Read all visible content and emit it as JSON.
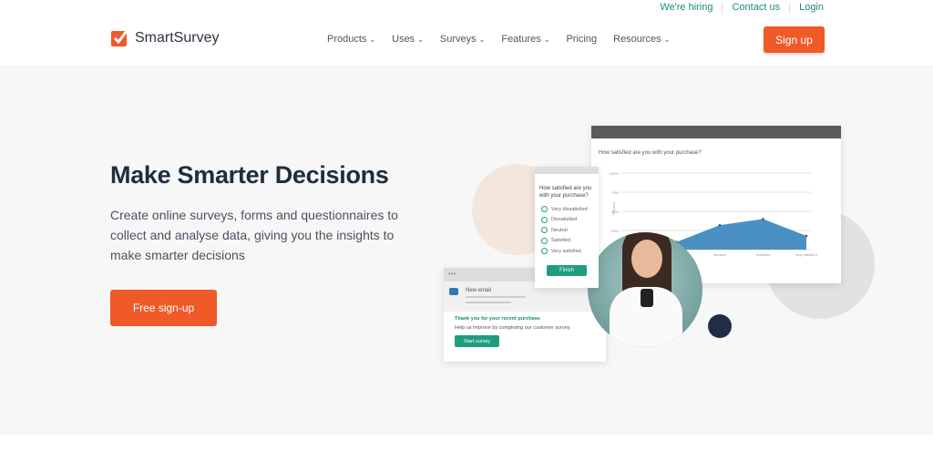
{
  "top_links": [
    "We're hiring",
    "Contact us",
    "Login"
  ],
  "brand": {
    "name": "SmartSurvey",
    "color": "#f05a28"
  },
  "nav": [
    {
      "label": "Products",
      "dropdown": true
    },
    {
      "label": "Uses",
      "dropdown": true
    },
    {
      "label": "Surveys",
      "dropdown": true
    },
    {
      "label": "Features",
      "dropdown": true
    },
    {
      "label": "Pricing",
      "dropdown": false
    },
    {
      "label": "Resources",
      "dropdown": true
    }
  ],
  "signup_label": "Sign up",
  "hero": {
    "title": "Make Smarter Decisions",
    "subtitle": "Create online surveys, forms and questionnaires to collect and analyse data, giving you the insights to make smarter decisions",
    "cta": "Free sign-up"
  },
  "illustration": {
    "chart_question": "How satisfied are you with your purchase?",
    "y_ticks": [
      "100%",
      "75%",
      "50%",
      "25%"
    ],
    "y_label": "Percent",
    "x_labels": [
      "Very dissatisfied",
      "Dissatisfied",
      "Neutral",
      "Satisfied",
      "Very satisfied"
    ],
    "values": [
      8,
      10,
      32,
      40,
      18
    ],
    "chart_color": "#4a90c2",
    "phone_question": "How satisfied are you with your purchase?",
    "options": [
      "Very dissatisfied",
      "Dissatisfied",
      "Neutral",
      "Satisfied",
      "Very satisfied"
    ],
    "finish": "Finish",
    "email_label": "New email",
    "email_title": "Thank you for your recent purchase",
    "email_body": "Help us improve by completing our customer survey.",
    "start_survey": "Start survey"
  }
}
